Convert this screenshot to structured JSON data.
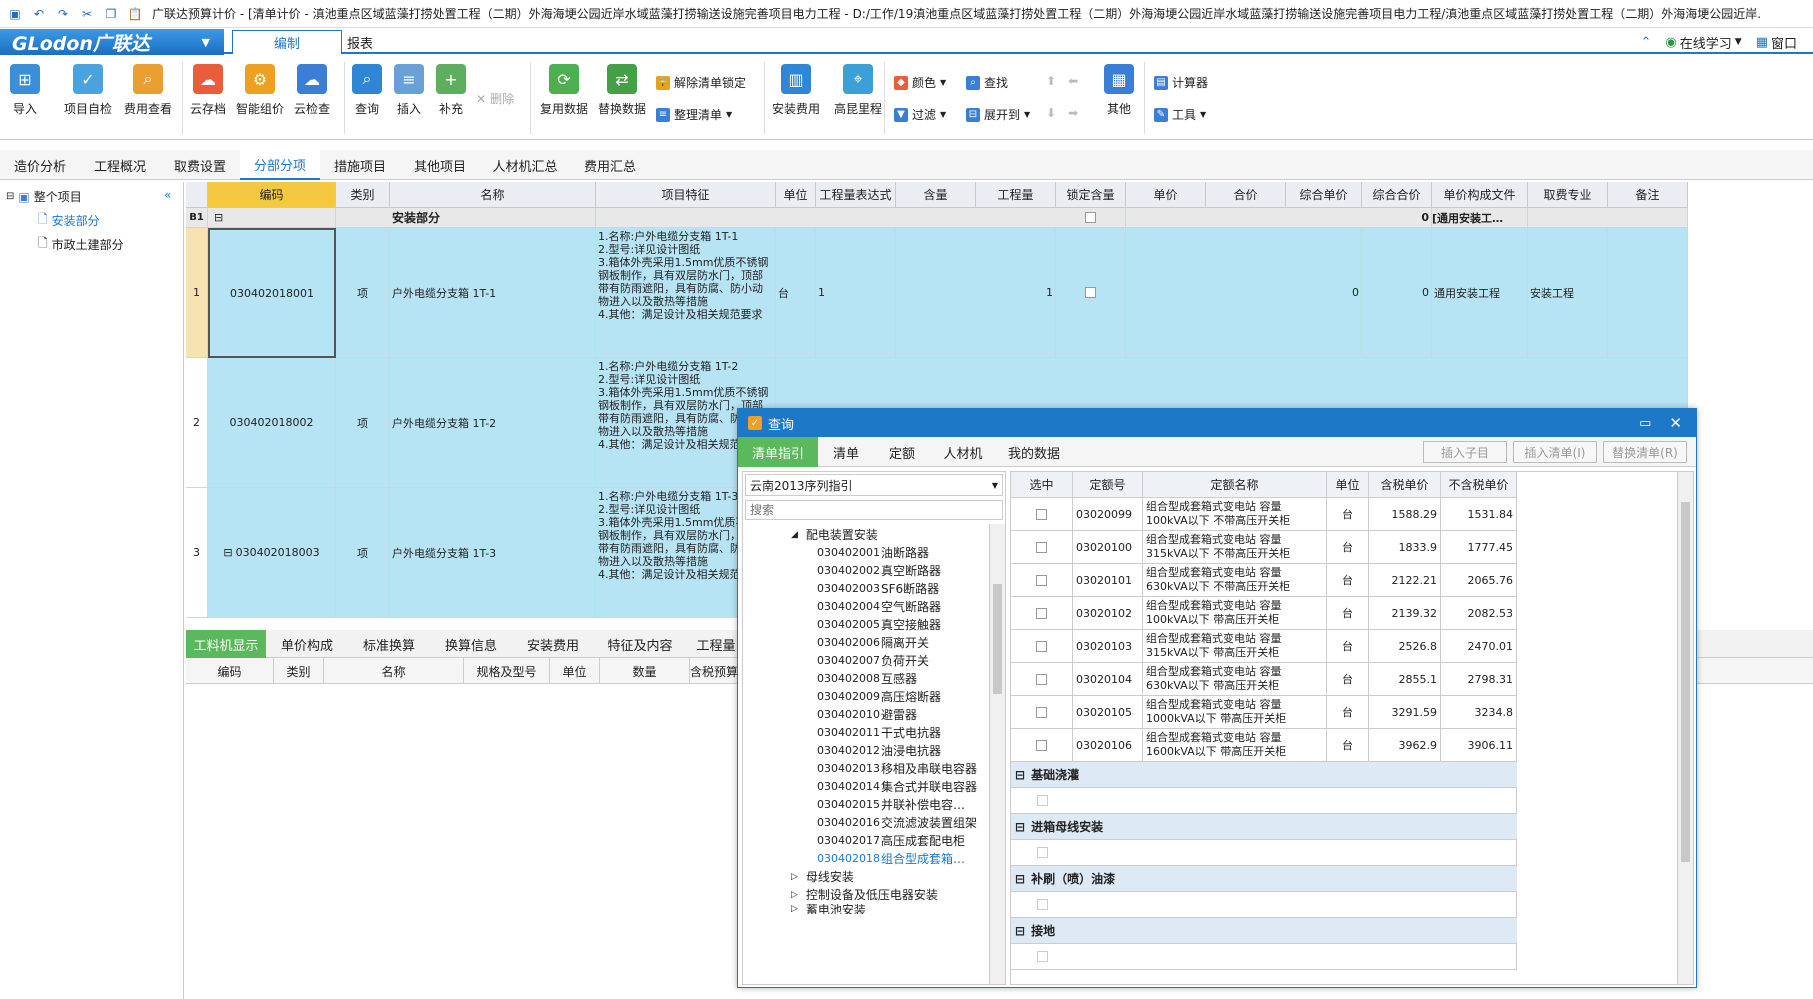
{
  "title_bar": {
    "text": "广联达预算计价 - [清单计价 - 滇池重点区域蓝藻打捞处置工程（二期）外海海埂公园近岸水域蓝藻打捞输送设施完善项目电力工程 - D:/工作/19滇池重点区域蓝藻打捞处置工程（二期）外海海埂公园近岸水域蓝藻打捞输送设施完善项目电力工程/滇池重点区域蓝藻打捞处置工程（二期）外海海埂公园近岸..."
  },
  "menu": {
    "logo": "GLodon广联达",
    "tabs": [
      "编制",
      "报表"
    ],
    "right": {
      "study": "在线学习",
      "window": "窗口"
    }
  },
  "ribbon": {
    "import": "导入",
    "self_check": "项目自检",
    "fee_view": "费用查看",
    "cloud_store": "云存档",
    "smart_price": "智能组价",
    "cloud_check": "云检查",
    "query": "查询",
    "insert": "插入",
    "supplement": "补充",
    "delete": "删除",
    "reuse": "复用数据",
    "replace": "替换数据",
    "unlock_list": "解除清单锁定",
    "organize_list": "整理清单",
    "install_fee": "安装费用",
    "gaoyuan": "高昆里程",
    "color": "颜色",
    "find": "查找",
    "filter": "过滤",
    "expand": "展开到",
    "other": "其他",
    "calc": "计算器",
    "tools": "工具"
  },
  "main_tabs": [
    "造价分析",
    "工程概况",
    "取费设置",
    "分部分项",
    "措施项目",
    "其他项目",
    "人材机汇总",
    "费用汇总"
  ],
  "tree": {
    "root": "整个项目",
    "items": [
      "安装部分",
      "市政土建部分"
    ]
  },
  "grid": {
    "headers": [
      "编码",
      "类别",
      "名称",
      "项目特征",
      "单位",
      "工程量表达式",
      "含量",
      "工程量",
      "锁定含量",
      "单价",
      "合价",
      "综合单价",
      "综合合价",
      "单价构成文件",
      "取费专业",
      "备注"
    ],
    "section": {
      "id": "B1",
      "name": "安装部分",
      "total": "0",
      "file": "[通用安装工…"
    },
    "rows": [
      {
        "num": "1",
        "code": "030402018001",
        "type": "项",
        "name": "户外电缆分支箱 1T-1",
        "feature": "1.名称:户外电缆分支箱 1T-1\n2.型号:详见设计图纸\n3.箱体外壳采用1.5mm优质不锈钢钢板制作，具有双层防水门，顶部带有防雨遮阳，具有防腐、防小动物进入以及散热等措施\n4.其他：满足设计及相关规范要求",
        "unit": "台",
        "expr": "1",
        "qty": "1",
        "unit_price": "0",
        "total": "0",
        "file": "通用安装工程",
        "major": "安装工程"
      },
      {
        "num": "2",
        "code": "030402018002",
        "type": "项",
        "name": "户外电缆分支箱 1T-2",
        "feature": "1.名称:户外电缆分支箱 1T-2\n2.型号:详见设计图纸\n3.箱体外壳采用1.5mm优质不锈钢钢板制作，具有双层防水门，顶部带有防雨遮阳，具有防腐、防小动物进入以及散热等措施\n4.其他：满足设计及相关规范要求"
      },
      {
        "num": "3",
        "code": "030402018003",
        "type": "项",
        "name": "户外电缆分支箱 1T-3",
        "feature": "1.名称:户外电缆分支箱 1T-3\n2.型号:详见设计图纸\n3.箱体外壳采用1.5mm优质不锈钢钢板制作，具有双层防水门，顶部带有防雨遮阳，具有防腐、防小动物进入以及散热等措施\n4.其他：满足设计及相关规范要求"
      }
    ]
  },
  "bottom_tabs": [
    "工料机显示",
    "单价构成",
    "标准换算",
    "换算信息",
    "安装费用",
    "特征及内容",
    "工程量"
  ],
  "bottom_headers": [
    "编码",
    "类别",
    "名称",
    "规格及型号",
    "单位",
    "数量",
    "含税预算价"
  ],
  "dialog": {
    "title": "查询",
    "tabs": [
      "清单指引",
      "清单",
      "定额",
      "人材机",
      "我的数据"
    ],
    "buttons": [
      "插入子目",
      "插入清单(I)",
      "替换清单(R)"
    ],
    "library": "云南2013序列指引",
    "search_placeholder": "搜索",
    "tree_parent": "配电装置安装",
    "tree_items": [
      {
        "code": "030402001",
        "name": "油断路器"
      },
      {
        "code": "030402002",
        "name": "真空断路器"
      },
      {
        "code": "030402003",
        "name": "SF6断路器"
      },
      {
        "code": "030402004",
        "name": "空气断路器"
      },
      {
        "code": "030402005",
        "name": "真空接触器"
      },
      {
        "code": "030402006",
        "name": "隔离开关"
      },
      {
        "code": "030402007",
        "name": "负荷开关"
      },
      {
        "code": "030402008",
        "name": "互感器"
      },
      {
        "code": "030402009",
        "name": "高压熔断器"
      },
      {
        "code": "030402010",
        "name": "避雷器"
      },
      {
        "code": "030402011",
        "name": "干式电抗器"
      },
      {
        "code": "030402012",
        "name": "油浸电抗器"
      },
      {
        "code": "030402013",
        "name": "移相及串联电容器"
      },
      {
        "code": "030402014",
        "name": "集合式并联电容器"
      },
      {
        "code": "030402015",
        "name": "并联补偿电容…"
      },
      {
        "code": "030402016",
        "name": "交流滤波装置组架"
      },
      {
        "code": "030402017",
        "name": "高压成套配电柜"
      },
      {
        "code": "030402018",
        "name": "组合型成套箱…"
      }
    ],
    "tree_more": [
      "母线安装",
      "控制设备及低压电器安装",
      "蓄电池安装"
    ],
    "result_headers": [
      "选中",
      "定额号",
      "定额名称",
      "单位",
      "含税单价",
      "不含税单价"
    ],
    "results": [
      {
        "code": "03020099",
        "name": "组合型成套箱式变电站 容量100kVA以下 不带高压开关柜",
        "unit": "台",
        "tax": "1588.29",
        "notax": "1531.84"
      },
      {
        "code": "03020100",
        "name": "组合型成套箱式变电站 容量315kVA以下 不带高压开关柜",
        "unit": "台",
        "tax": "1833.9",
        "notax": "1777.45"
      },
      {
        "code": "03020101",
        "name": "组合型成套箱式变电站 容量630kVA以下 不带高压开关柜",
        "unit": "台",
        "tax": "2122.21",
        "notax": "2065.76"
      },
      {
        "code": "03020102",
        "name": "组合型成套箱式变电站 容量100kVA以下 带高压开关柜",
        "unit": "台",
        "tax": "2139.32",
        "notax": "2082.53"
      },
      {
        "code": "03020103",
        "name": "组合型成套箱式变电站 容量315kVA以下 带高压开关柜",
        "unit": "台",
        "tax": "2526.8",
        "notax": "2470.01"
      },
      {
        "code": "03020104",
        "name": "组合型成套箱式变电站 容量630kVA以下 带高压开关柜",
        "unit": "台",
        "tax": "2855.1",
        "notax": "2798.31"
      },
      {
        "code": "03020105",
        "name": "组合型成套箱式变电站 容量1000kVA以下 带高压开关柜",
        "unit": "台",
        "tax": "3291.59",
        "notax": "3234.8"
      },
      {
        "code": "03020106",
        "name": "组合型成套箱式变电站 容量1600kVA以下 带高压开关柜",
        "unit": "台",
        "tax": "3962.9",
        "notax": "3906.11"
      }
    ],
    "groups": [
      "基础浇灌",
      "进箱母线安装",
      "补刷（喷）油漆",
      "接地"
    ]
  }
}
